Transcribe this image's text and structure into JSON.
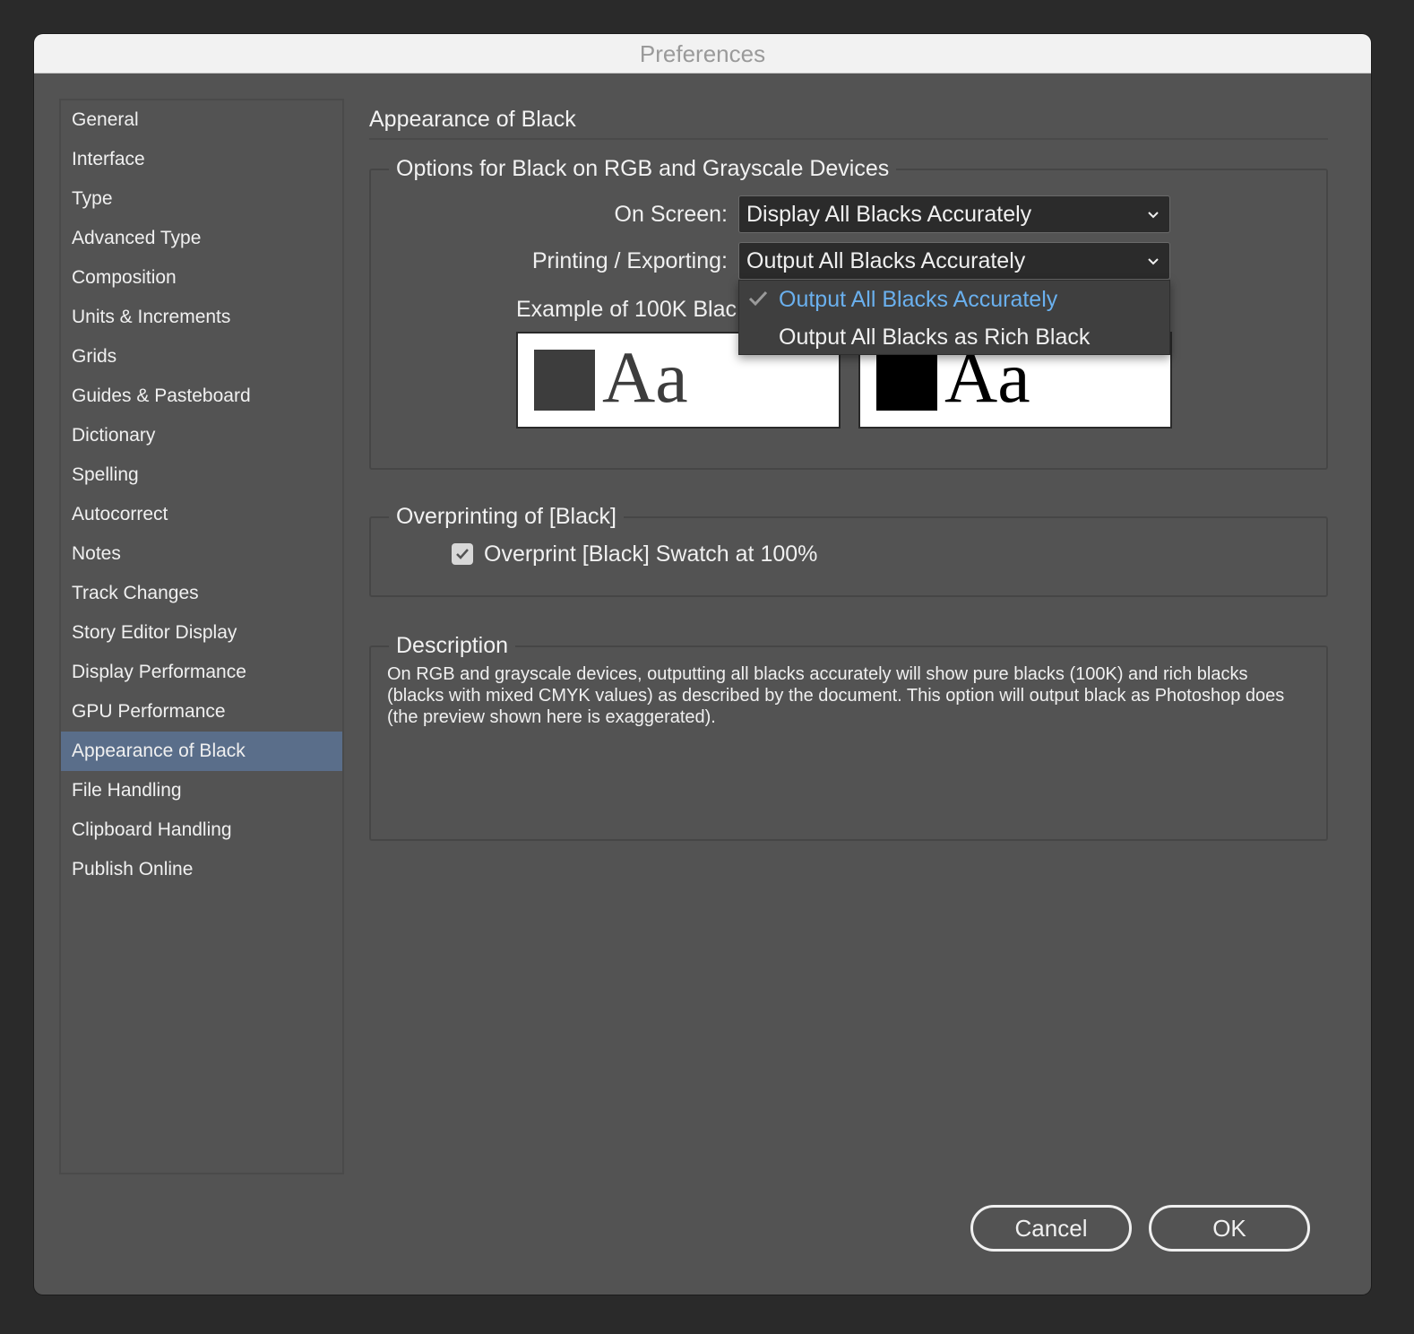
{
  "window": {
    "title": "Preferences"
  },
  "sidebar": {
    "items": [
      {
        "label": "General"
      },
      {
        "label": "Interface"
      },
      {
        "label": "Type"
      },
      {
        "label": "Advanced Type"
      },
      {
        "label": "Composition"
      },
      {
        "label": "Units & Increments"
      },
      {
        "label": "Grids"
      },
      {
        "label": "Guides & Pasteboard"
      },
      {
        "label": "Dictionary"
      },
      {
        "label": "Spelling"
      },
      {
        "label": "Autocorrect"
      },
      {
        "label": "Notes"
      },
      {
        "label": "Track Changes"
      },
      {
        "label": "Story Editor Display"
      },
      {
        "label": "Display Performance"
      },
      {
        "label": "GPU Performance"
      },
      {
        "label": "Appearance of Black"
      },
      {
        "label": "File Handling"
      },
      {
        "label": "Clipboard Handling"
      },
      {
        "label": "Publish Online"
      }
    ],
    "selected": "Appearance of Black"
  },
  "main": {
    "section_title": "Appearance of Black",
    "rgb_group": {
      "legend": "Options for Black on RGB and Grayscale Devices",
      "on_screen_label": "On Screen:",
      "on_screen_value": "Display All Blacks Accurately",
      "printing_label": "Printing / Exporting:",
      "printing_value": "Output All Blacks Accurately",
      "example_label": "Example of 100K Blac",
      "swatch_text": "Aa",
      "swatch_colors": {
        "accurate": "#3d3d3d",
        "rich": "#000000"
      }
    },
    "dropdown": {
      "options": [
        {
          "label": "Output All Blacks Accurately",
          "selected": true
        },
        {
          "label": "Output All Blacks as Rich Black",
          "selected": false
        }
      ]
    },
    "overprint_group": {
      "legend": "Overprinting of [Black]",
      "checkbox_label": "Overprint [Black] Swatch at 100%",
      "checked": true
    },
    "description_group": {
      "legend": "Description",
      "text": "On RGB and grayscale devices, outputting all blacks accurately will show pure blacks (100K) and rich blacks (blacks with mixed CMYK values) as described by the document. This option will output black as Photoshop does (the preview shown here is exaggerated)."
    }
  },
  "footer": {
    "cancel_label": "Cancel",
    "ok_label": "OK"
  },
  "colors": {
    "selection_highlight": "#5a6e8a",
    "menu_selected_text": "#6ab0ee"
  }
}
